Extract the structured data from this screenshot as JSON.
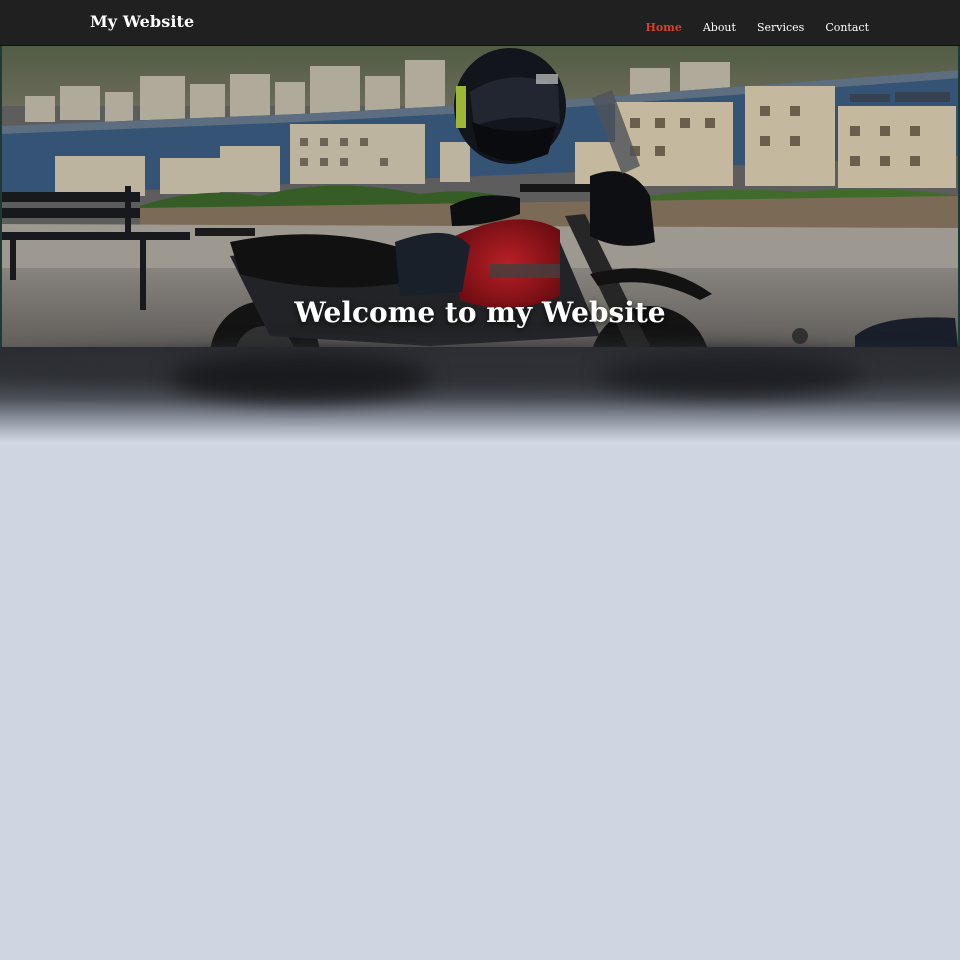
{
  "navbar": {
    "brand": "My Website",
    "links": [
      {
        "label": "Home",
        "active": true
      },
      {
        "label": "About",
        "active": false
      },
      {
        "label": "Services",
        "active": false
      },
      {
        "label": "Contact",
        "active": false
      }
    ]
  },
  "hero": {
    "title": "Welcome to my Website",
    "image_subject": "motorcycle with helmet parked on a promenade above a harbour town"
  },
  "colors": {
    "navbar_bg": "#202020",
    "active_link": "#d6402c",
    "page_bg": "#d0d6e1"
  }
}
